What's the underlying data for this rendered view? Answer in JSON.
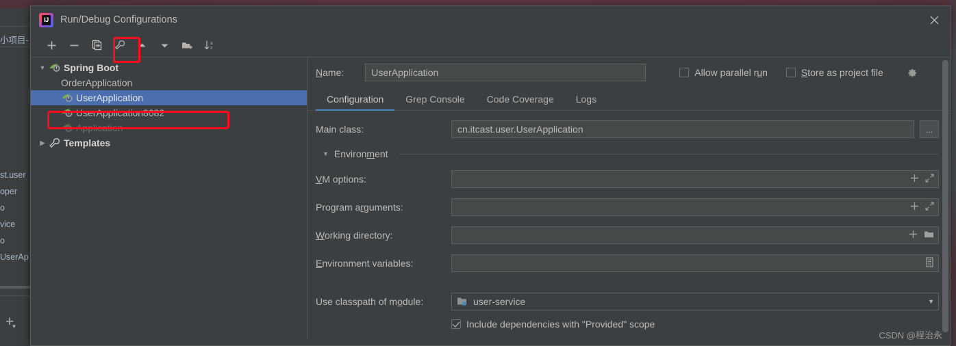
{
  "background": {
    "project_label": "小项目-",
    "tree_items": [
      "st.user",
      "oper",
      "o",
      "vice",
      "o",
      "UserAp"
    ],
    "add_icon": "plus-icon"
  },
  "dialog": {
    "title": "Run/Debug Configurations",
    "logo_text": "IJ",
    "close_icon": "close-icon",
    "toolbar": [
      {
        "name": "add-configuration-button",
        "icon": "plus-icon",
        "highlighted": false
      },
      {
        "name": "remove-configuration-button",
        "icon": "minus-icon",
        "highlighted": false
      },
      {
        "name": "copy-configuration-button",
        "icon": "copy-icon",
        "highlighted": true
      },
      {
        "name": "edit-templates-button",
        "icon": "wrench-icon",
        "highlighted": false
      },
      {
        "name": "move-up-button",
        "icon": "arrow-up-icon",
        "highlighted": false
      },
      {
        "name": "move-down-button",
        "icon": "arrow-down-icon",
        "highlighted": false
      },
      {
        "name": "new-folder-button",
        "icon": "folder-add-icon",
        "highlighted": false
      },
      {
        "name": "sort-configurations-button",
        "icon": "sort-az-icon",
        "highlighted": false
      }
    ]
  },
  "tree": {
    "group": {
      "label": "Spring Boot",
      "icon": "spring-boot-icon",
      "expanded": true
    },
    "items": [
      {
        "label": "OrderApplication",
        "icon": "none",
        "state": "normal"
      },
      {
        "label": "UserApplication",
        "icon": "spring-boot-icon",
        "state": "selected"
      },
      {
        "label": "UserApplication8082",
        "icon": "spring-boot-icon",
        "state": "highlighted"
      },
      {
        "label": "Application",
        "icon": "spring-boot-icon",
        "state": "dim"
      }
    ],
    "templates": {
      "label": "Templates",
      "icon": "wrench-icon",
      "expanded": false
    }
  },
  "form": {
    "name_label": "Name:",
    "name_value": "UserApplication",
    "allow_parallel_run": {
      "label": "Allow parallel run",
      "checked": false
    },
    "store_as_project_file": {
      "label": "Store as project file",
      "checked": false
    },
    "gear_icon": "gear-icon",
    "tabs": [
      {
        "label": "Configuration",
        "active": true
      },
      {
        "label": "Grep Console",
        "active": false
      },
      {
        "label": "Code Coverage",
        "active": false
      },
      {
        "label": "Logs",
        "active": false
      }
    ],
    "main_class": {
      "label": "Main class:",
      "value": "cn.itcast.user.UserApplication",
      "browse_label": "..."
    },
    "environment_section": {
      "label": "Environment",
      "expanded": true
    },
    "vm_options": {
      "label": "VM options:",
      "value": "",
      "icons": [
        "plus-icon",
        "expand-icon"
      ]
    },
    "program_arguments": {
      "label": "Program arguments:",
      "value": "",
      "icons": [
        "plus-icon",
        "expand-icon"
      ]
    },
    "working_directory": {
      "label": "Working directory:",
      "value": "",
      "icons": [
        "plus-icon",
        "folder-icon"
      ]
    },
    "environment_variables": {
      "label": "Environment variables:",
      "value": "",
      "icons": [
        "list-icon"
      ]
    },
    "use_classpath": {
      "label": "Use classpath of module:",
      "value": "user-service",
      "icon": "module-icon",
      "arrow": "chevron-down-icon"
    },
    "include_provided": {
      "label": "Include dependencies with \"Provided\" scope",
      "checked": true
    }
  },
  "watermark": "CSDN @程治永",
  "colors": {
    "selection": "#4b6eaf",
    "highlight": "#fc0d1c",
    "tab_underline": "#4a88c7",
    "panel_bg": "#3c3f41",
    "field_bg": "#45494a"
  }
}
